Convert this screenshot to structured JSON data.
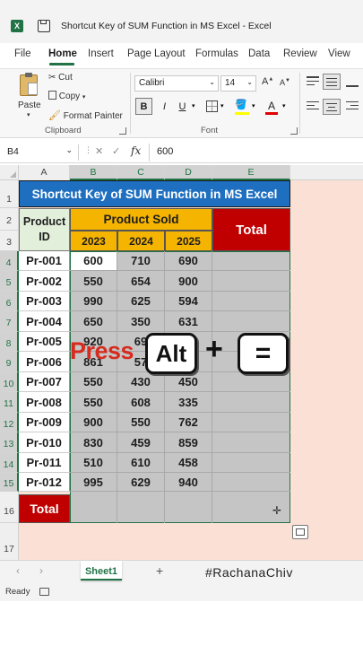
{
  "window": {
    "title": "Shortcut Key of SUM Function in MS Excel  -  Excel"
  },
  "ribbon_tabs": [
    "File",
    "Home",
    "Insert",
    "Page Layout",
    "Formulas",
    "Data",
    "Review",
    "View"
  ],
  "active_tab": "Home",
  "clipboard": {
    "paste": "Paste",
    "cut": "Cut",
    "copy": "Copy",
    "format_painter": "Format Painter",
    "group": "Clipboard"
  },
  "font": {
    "name": "Calibri",
    "size": "14",
    "bold": "B",
    "italic": "I",
    "underline": "U",
    "font_color_letter": "A",
    "group": "Font"
  },
  "formula_bar": {
    "name_box": "B4",
    "fx": "fx",
    "value": "600",
    "cancel": "✕",
    "enter": "✓"
  },
  "columns": [
    "A",
    "B",
    "C",
    "D",
    "E"
  ],
  "rows": [
    "1",
    "2",
    "3",
    "4",
    "5",
    "6",
    "7",
    "8",
    "9",
    "10",
    "11",
    "12",
    "13",
    "14",
    "15",
    "16",
    "17"
  ],
  "sheet": {
    "banner": "Shortcut Key of SUM Function in MS Excel",
    "product_id_header": "Product ID",
    "product_sold_header": "Product Sold",
    "total_header": "Total",
    "years": [
      "2023",
      "2024",
      "2025"
    ],
    "total_row_label": "Total",
    "records": [
      {
        "id": "Pr-001",
        "v": [
          "600",
          "710",
          "690"
        ]
      },
      {
        "id": "Pr-002",
        "v": [
          "550",
          "654",
          "900"
        ]
      },
      {
        "id": "Pr-003",
        "v": [
          "990",
          "625",
          "594"
        ]
      },
      {
        "id": "Pr-004",
        "v": [
          "650",
          "350",
          "631"
        ]
      },
      {
        "id": "Pr-005",
        "v": [
          "920",
          "69",
          ""
        ]
      },
      {
        "id": "Pr-006",
        "v": [
          "861",
          "57",
          ""
        ]
      },
      {
        "id": "Pr-007",
        "v": [
          "550",
          "430",
          "450"
        ]
      },
      {
        "id": "Pr-008",
        "v": [
          "550",
          "608",
          "335"
        ]
      },
      {
        "id": "Pr-009",
        "v": [
          "900",
          "550",
          "762"
        ]
      },
      {
        "id": "Pr-010",
        "v": [
          "830",
          "459",
          "859"
        ]
      },
      {
        "id": "Pr-011",
        "v": [
          "510",
          "610",
          "458"
        ]
      },
      {
        "id": "Pr-012",
        "v": [
          "995",
          "629",
          "940"
        ]
      }
    ]
  },
  "overlay": {
    "press": "Press",
    "key1": "Alt",
    "plus": "+",
    "key2": "="
  },
  "sheet_tabs": {
    "active": "Sheet1",
    "add": "+",
    "watermark": "#RachanaChiv"
  },
  "status": {
    "mode": "Ready"
  },
  "colors": {
    "excel_green": "#217346",
    "banner_blue": "#1f6fc0",
    "header_yellow": "#f5b400",
    "total_red": "#c00000",
    "light_green": "#e2efda",
    "selection_gray": "#c5c5c5",
    "salmon_bg": "#fbe1d5"
  }
}
